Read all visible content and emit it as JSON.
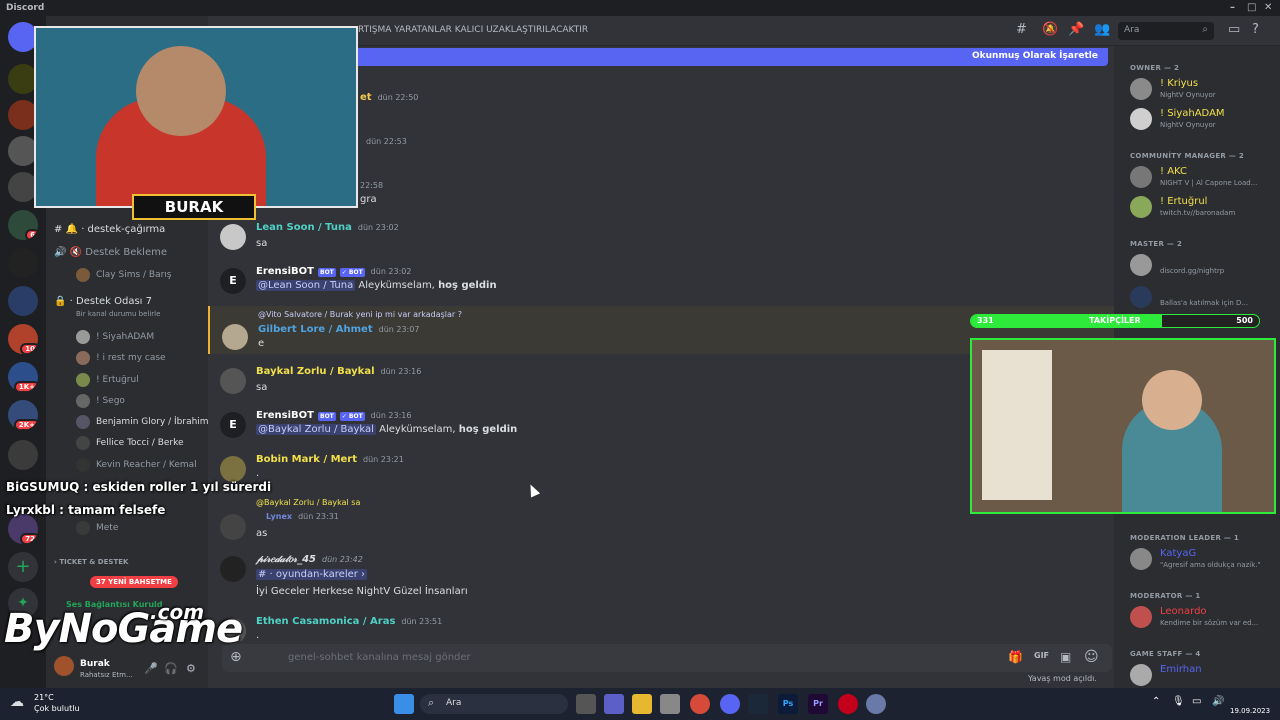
{
  "window": {
    "app_name": "Discord"
  },
  "channel_header": {
    "topic": "RTIŞMA YARATANLAR KALICI UZAKLAŞTIRILACAKTIR",
    "search_placeholder": "Ara"
  },
  "banner": {
    "mark_read": "Okunmuş Olarak İşaretle"
  },
  "guild_badges": [
    "6",
    "10",
    "1K+",
    "2K+",
    "72"
  ],
  "sidebar": {
    "channels": [
      {
        "name": "destek-çağırma"
      },
      {
        "name": "Destek Bekleme"
      },
      {
        "name": "Destek Odası 7",
        "status": "Bir kanal durumu belirle"
      }
    ],
    "voice_members": [
      "Clay Sims / Barış",
      "! SiyahADAM",
      "! i rest my case",
      "! Ertuğrul",
      "! Sego",
      "Benjamin Glory / İbrahim",
      "Fellice Tocci / Berke",
      "Kevin Reacher / Kemal",
      "Mete"
    ],
    "category": "TICKET & DESTEK",
    "new_badge": "37 YENİ BAHSETME",
    "voice_status": "Ses Bağlantısı Kuruld",
    "user": {
      "name": "Burak",
      "status": "Rahatsız Etm..."
    }
  },
  "overlay": {
    "chat_line_1": "BiGSUMUQ : eskiden roller 1 yıl sürerdi",
    "chat_line_2": "Lyrxkbl : tamam felsefe",
    "streamer_tag": "BURAK",
    "logo": "ByNoGame",
    "logo_suffix": ".com",
    "followers_label": "TAKİPÇİLER",
    "followers_current": "331",
    "followers_goal": "500"
  },
  "messages": [
    {
      "author": "",
      "time": "dün 22:50",
      "text": ""
    },
    {
      "author": "",
      "time": "dün 22:53",
      "text": ""
    },
    {
      "author": "",
      "time": "22:58",
      "text": "gra"
    },
    {
      "author": "Lean Soon / Tuna",
      "time": "dün 23:02",
      "text": "sa"
    },
    {
      "author": "ErensiBOT",
      "time": "dün 23:02",
      "mention": "@Lean Soon / Tuna",
      "text": "Aleykümselam,",
      "bold": "hoş geldin"
    },
    {
      "reply": "@Vito Salvatore / Burak yeni ip mi var arkadaşlar ?",
      "author": "Gilbert Lore / Ahmet",
      "time": "dün 23:07",
      "text": "e"
    },
    {
      "author": "Baykal Zorlu / Baykal",
      "time": "dün 23:16",
      "text": "sa"
    },
    {
      "author": "ErensiBOT",
      "time": "dün 23:16",
      "mention": "@Baykal Zorlu / Baykal",
      "text": "Aleykümselam,",
      "bold": "hoş geldin"
    },
    {
      "author": "Bobin Mark  / Mert",
      "time": "dün 23:21",
      "text": "."
    },
    {
      "reply": "@Baykal Zorlu / Baykal sa",
      "author": "Lynex",
      "time": "dün 23:31",
      "text": "as"
    },
    {
      "author": "𝓅𝒾𝓇𝑒𝒹𝒶𝓉𝑜𝓇_45",
      "time": "dün 23:42",
      "channel": "#  · oyundan-kareler ›",
      "text": "İyi Geceler Herkese NightV Güzel İnsanları"
    },
    {
      "author": "Ethen Casamonica / Aras",
      "time": "dün 23:51",
      "text": "."
    }
  ],
  "composer": {
    "placeholder": "genel-sohbet kanalına mesaj gönder",
    "slowmode": "Yavaş mod açıldı."
  },
  "members": {
    "groups": [
      {
        "title": "OWNER — 2",
        "members": [
          {
            "name": "! Kriyus",
            "status": "NightV Oynuyor"
          },
          {
            "name": "! SiyahADAM",
            "status": "NightV Oynuyor"
          }
        ]
      },
      {
        "title": "COMMUNİTY MANAGER — 2",
        "members": [
          {
            "name": "! AKC",
            "status": "NIGHT V | Al Capone Load..."
          },
          {
            "name": "! Ertuğrul",
            "status": "twitch.tv//baronadam"
          }
        ]
      },
      {
        "title": "MASTER — 2",
        "members": [
          {
            "name": "",
            "status": "discord.gg/nightrp"
          },
          {
            "name": "",
            "status": "Ballas'a katılmak için D..."
          }
        ]
      },
      {
        "title": "MODERATION LEADER — 1",
        "members": [
          {
            "name": "KatyaG",
            "status": "\"Agresif ama oldukça nazik.\""
          }
        ]
      },
      {
        "title": "MODERATOR — 1",
        "members": [
          {
            "name": "Leonardo",
            "status": "Kendime bir sözüm var ed..."
          }
        ]
      },
      {
        "title": "GAME STAFF — 4",
        "members": [
          {
            "name": "Emirhan",
            "status": ""
          }
        ]
      }
    ]
  },
  "taskbar": {
    "weather_temp": "21°C",
    "weather_desc": "Çok bulutlu",
    "search": "Ara",
    "date": "19.09.2023"
  }
}
